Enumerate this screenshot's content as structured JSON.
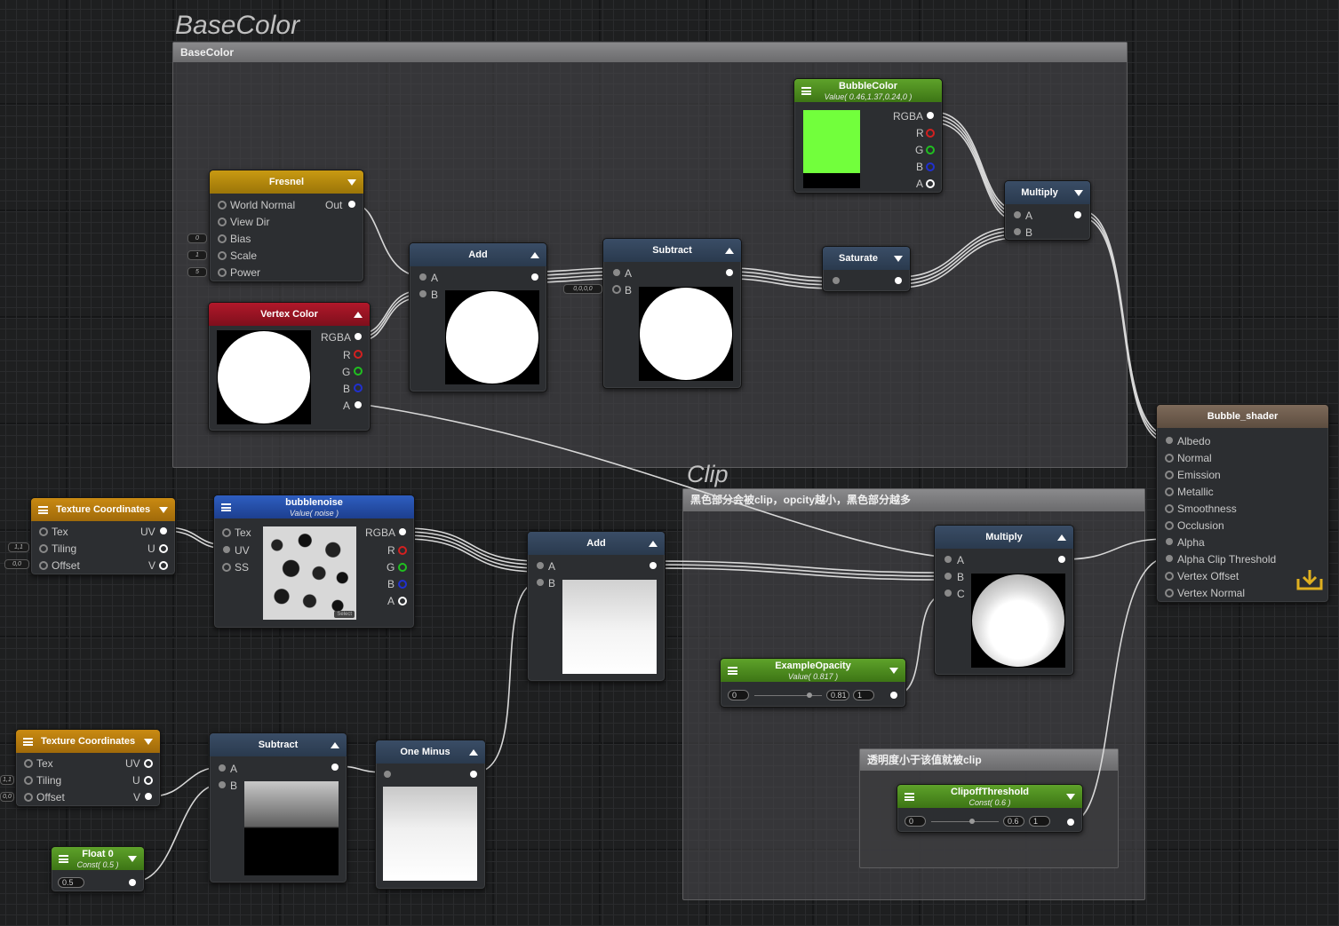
{
  "groups": {
    "basecolor": {
      "title": "BaseColor",
      "bar": "BaseColor"
    },
    "clip": {
      "title": "Clip",
      "bar": "黑色部分会被clip，opcity越小，黑色部分越多"
    },
    "threshold": {
      "bar": "透明度小于该值就被clip"
    }
  },
  "nodes": {
    "fresnel": {
      "title": "Fresnel",
      "inputs": [
        "World Normal",
        "View Dir",
        "Bias",
        "Scale",
        "Power"
      ],
      "output": "Out",
      "chips": [
        "0",
        "1",
        "5"
      ]
    },
    "vertex_color": {
      "title": "Vertex Color",
      "outputs": [
        "RGBA",
        "R",
        "G",
        "B",
        "A"
      ]
    },
    "add1": {
      "title": "Add",
      "inputs": [
        "A",
        "B"
      ]
    },
    "subtract1": {
      "title": "Subtract",
      "inputs": [
        "A",
        "B"
      ],
      "chip": "0,0,0,0"
    },
    "saturate": {
      "title": "Saturate"
    },
    "bubble_color": {
      "title": "BubbleColor",
      "subtitle": "Value( 0.46,1.37,0.24,0 )",
      "outputs": [
        "RGBA",
        "R",
        "G",
        "B",
        "A"
      ],
      "swatch": "#72ff3c"
    },
    "multiply1": {
      "title": "Multiply",
      "inputs": [
        "A",
        "B"
      ]
    },
    "bubble_shader": {
      "title": "Bubble_shader",
      "inputs": [
        "Albedo",
        "Normal",
        "Emission",
        "Metallic",
        "Smoothness",
        "Occlusion",
        "Alpha",
        "Alpha Clip Threshold",
        "Vertex Offset",
        "Vertex Normal"
      ]
    },
    "texcoord1": {
      "title": "Texture Coordinates",
      "inputs": [
        "Tex",
        "Tiling",
        "Offset"
      ],
      "outputs": [
        "UV",
        "U",
        "V"
      ],
      "chips": [
        "1,1",
        "0,0"
      ]
    },
    "bubblenoise": {
      "title": "bubblenoise",
      "subtitle": "Value( noise )",
      "inputs": [
        "Tex",
        "UV",
        "SS"
      ],
      "outputs": [
        "RGBA",
        "R",
        "G",
        "B",
        "A"
      ],
      "select_label": "Select"
    },
    "add2": {
      "title": "Add",
      "inputs": [
        "A",
        "B"
      ]
    },
    "multiply2": {
      "title": "Multiply",
      "inputs": [
        "A",
        "B",
        "C"
      ]
    },
    "example_opacity": {
      "title": "ExampleOpacity",
      "subtitle": "Value( 0.817 )",
      "min": "0",
      "value": "0.81",
      "max": "1",
      "level": 0.817
    },
    "clipoff_threshold": {
      "title": "ClipoffThreshold",
      "subtitle": "Const( 0.6 )",
      "min": "0",
      "value": "0.6",
      "max": "1",
      "level": 0.6
    },
    "texcoord2": {
      "title": "Texture Coordinates",
      "inputs": [
        "Tex",
        "Tiling",
        "Offset"
      ],
      "outputs": [
        "UV",
        "U",
        "V"
      ],
      "chips": [
        "1,1",
        "0,0"
      ]
    },
    "float0": {
      "title": "Float 0",
      "subtitle": "Const( 0.5 )",
      "value": "0.5"
    },
    "subtract2": {
      "title": "Subtract",
      "inputs": [
        "A",
        "B"
      ]
    },
    "one_minus": {
      "title": "One Minus"
    }
  },
  "colors": {
    "port_r": "#d42020",
    "port_g": "#20c020",
    "port_b": "#2030d0",
    "header_blue": "#34475e",
    "header_green": "#4f8c22",
    "header_yellow": "#b48a0e"
  }
}
